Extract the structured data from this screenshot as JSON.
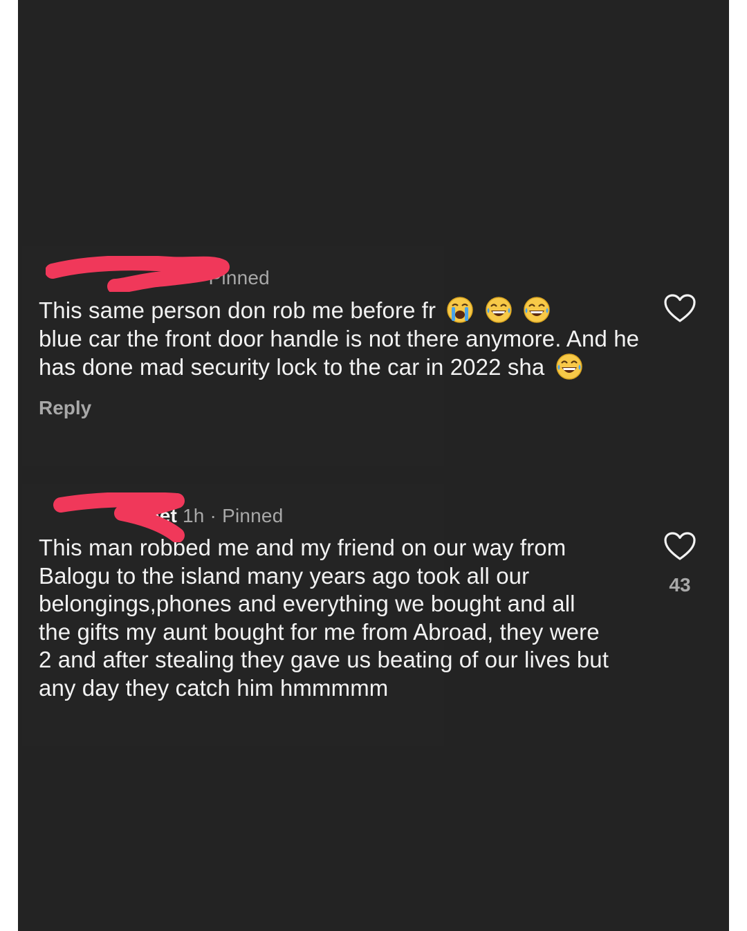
{
  "comments": [
    {
      "username": "",
      "time": "",
      "separator": "·",
      "pinned_label": "Pinned",
      "text": "This same person don rob me before fr",
      "emojis_after_first_line": [
        "loudly-crying-face",
        "face-with-tears-of-joy",
        "face-with-tears-of-joy"
      ],
      "text_continued": "blue car the front door handle is not there anymore. And he has done mad security lock to the car in 2022 sha",
      "trailing_emoji": "face-with-tears-of-joy",
      "reply_label": "Reply",
      "like_icon": "heart-outline-icon",
      "like_count": ""
    },
    {
      "username_visible_fragment": "eet",
      "time": "1h",
      "separator": "·",
      "pinned_label": "Pinned",
      "text": "This man robbed me and my friend on our way from Balogu to the island many years ago took all our belongings,phones and everything we bought and all the gifts my aunt bought for me from Abroad, they were 2 and after stealing they gave us beating of our lives but any day they catch him hmmmmm",
      "like_icon": "heart-outline-icon",
      "like_count": "43"
    }
  ],
  "colors": {
    "background": "#232323",
    "text_primary": "#f2f2f2",
    "text_secondary": "#a8a8a8",
    "redaction": "#f0385a"
  }
}
